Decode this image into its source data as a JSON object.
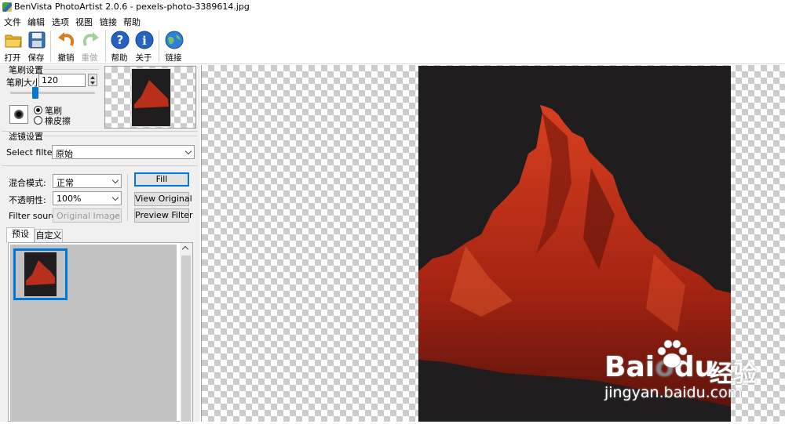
{
  "window": {
    "title": "BenVista PhotoArtist 2.0.6 - pexels-photo-3389614.jpg"
  },
  "menu": [
    "文件",
    "编辑",
    "选项",
    "视图",
    "链接",
    "帮助"
  ],
  "toolbar": {
    "open": "打开",
    "save": "保存",
    "undo": "撤销",
    "redo": "重做",
    "help": "帮助",
    "about": "关于",
    "link": "链接"
  },
  "brush": {
    "group_title": "笔刷设置",
    "size_label": "笔刷大小:",
    "size_value": "120",
    "slider_level": 0.3,
    "mode_brush": "笔刷",
    "mode_eraser": "橡皮擦"
  },
  "filter": {
    "group_title": "滤镜设置",
    "select_label": "Select filter:",
    "select_value": "原始",
    "blend_label": "混合模式:",
    "blend_value": "正常",
    "opacity_label": "不透明性:",
    "opacity_value": "100%",
    "source_label": "Filter source:",
    "source_value": "Original Image",
    "fill_button": "Fill",
    "view_original_button": "View Original",
    "preview_filter_button": "Preview Filter"
  },
  "tabs": {
    "presets": "预设",
    "custom": "自定义"
  },
  "watermark": {
    "brand": "Bai",
    "brand2": "du",
    "cn": "经验",
    "url": "jingyan.baidu.com"
  },
  "colors": {
    "accent": "#0078d7",
    "image_bg": "#1f1d1e",
    "mountain": "#c9301c"
  }
}
